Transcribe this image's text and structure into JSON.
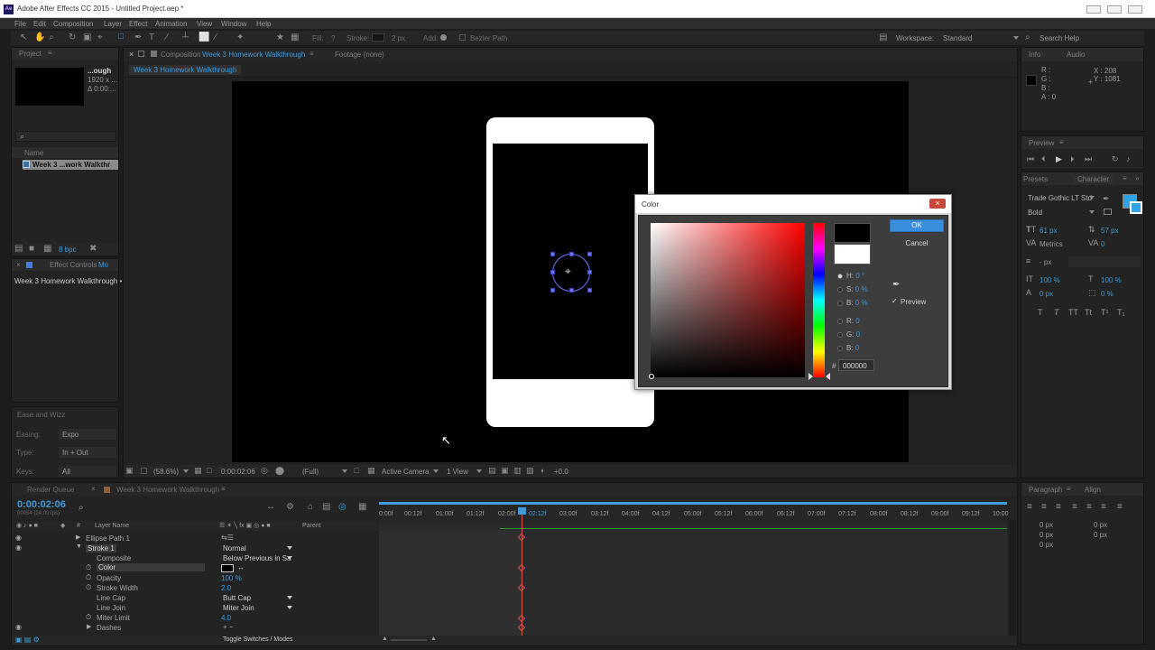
{
  "window": {
    "title": "Adobe After Effects CC 2015 - Untitled Project.aep *",
    "app_badge": "Ae"
  },
  "menu": [
    "File",
    "Edit",
    "Composition",
    "Layer",
    "Effect",
    "Animation",
    "View",
    "Window",
    "Help"
  ],
  "toolbar": {
    "fill_label": "Fill:",
    "fill_value": "?",
    "stroke_label": "Stroke:",
    "stroke_width": "2 px",
    "add_label": "Add:",
    "bezier_label": "Bezier Path",
    "workspace_label": "Workspace:",
    "workspace_value": "Standard",
    "search_placeholder": "Search Help"
  },
  "project": {
    "tab_label": "Project",
    "thumb_name": "...ough",
    "thumb_dims": "1920 x ...",
    "thumb_dur": "Δ 0:00:...",
    "search_icon": "search-icon",
    "col_name": "Name",
    "item_name": "Week 3 ...work Walkthr",
    "bpc": "8 bpc"
  },
  "effect_controls": {
    "tab_label": "Effect Controls",
    "tab_suffix": "Mo",
    "layer": "Week 3 Homework Walkthrough •"
  },
  "ease_panel": {
    "title": "Ease and Wizz",
    "easing_label": "Easing:",
    "easing_value": "Expo",
    "type_label": "Type:",
    "type_value": "In + Out",
    "keys_label": "Keys:",
    "keys_value": "All"
  },
  "comp_panel": {
    "close": "×",
    "tab_prefix": "Composition",
    "tab_name": "Week 3 Homework Walkthrough",
    "footage_tab": "Footage (none)",
    "breadcrumb": "Week 3 Homework Walkthrough",
    "zoom": "(58.6%)",
    "timecode": "0:00:02:06",
    "quality": "(Full)",
    "camera": "Active Camera",
    "views": "1 View",
    "exposure": "+0.0"
  },
  "info_panel": {
    "tab_info": "Info",
    "tab_audio": "Audio",
    "r": "R :",
    "g": "G :",
    "b": "B :",
    "a": "A : 0",
    "x": "X : 208",
    "y": "Y : 1081"
  },
  "preview_panel": {
    "tab": "Preview"
  },
  "character_panel": {
    "tab_presets": "Presets",
    "tab_character": "Character",
    "font": "Trade Gothic LT Std",
    "style": "Bold",
    "size": "61 px",
    "leading": "57 px",
    "kerning": "Metrics",
    "tracking": "0",
    "stroke_px": "- px",
    "vscale": "100 %",
    "hscale": "100 %",
    "baseline": "0 px",
    "tsume": "0 %"
  },
  "paragraph_panel": {
    "tab_paragraph": "Paragraph",
    "tab_align": "Align",
    "indent_left": "0 px",
    "indent_right": "0 px",
    "space_before": "0 px",
    "space_after": "0 px",
    "first_line": "0 px"
  },
  "timeline": {
    "tab_render_queue": "Render Queue",
    "tab_comp": "Week 3 Homework Walkthrough",
    "timecode": "0:00:02:06",
    "frame_info": "00054 (24.00 fps)",
    "col_layer_name": "Layer Name",
    "col_parent": "Parent",
    "ruler": [
      "0:00f",
      "00:12f",
      "01:00f",
      "01:12f",
      "02:00f",
      "02:12f",
      "03:00f",
      "03:12f",
      "04:00f",
      "04:12f",
      "05:00f",
      "05:12f",
      "06:00f",
      "06:12f",
      "07:00f",
      "07:12f",
      "08:00f",
      "08:12f",
      "09:00f",
      "09:12f",
      "10:00"
    ],
    "rows": [
      {
        "name": "Ellipse Path 1",
        "value": ""
      },
      {
        "name": "Stroke 1",
        "value": "Normal"
      },
      {
        "name": "Composite",
        "value": "Below Previous in Sa"
      },
      {
        "name": "Color",
        "value": ""
      },
      {
        "name": "Opacity",
        "value": "100 %"
      },
      {
        "name": "Stroke Width",
        "value": "2.0"
      },
      {
        "name": "Line Cap",
        "value": "Butt Cap"
      },
      {
        "name": "Line Join",
        "value": "Miter Join"
      },
      {
        "name": "Miter Limit",
        "value": "4.0"
      },
      {
        "name": "Dashes",
        "value": ""
      }
    ],
    "toggle_label": "Toggle Switches / Modes"
  },
  "color_dialog": {
    "title": "Color",
    "ok": "OK",
    "cancel": "Cancel",
    "h_label": "H:",
    "h_value": "0 °",
    "s_label": "S:",
    "s_value": "0 %",
    "b_label": "B:",
    "b_value": "0 %",
    "r_label": "R:",
    "r_value": "0",
    "g_label": "G:",
    "g_value": "0",
    "bb_label": "B:",
    "bb_value": "0",
    "hex_label": "#",
    "hex_value": "000000",
    "preview_label": "Preview",
    "new_color": "#000000",
    "old_color": "#ffffff"
  },
  "colors": {
    "accent": "#3e9ad8",
    "keyframe": "#d9534f",
    "work_area": "#2a9b2a",
    "selection": "#6f74ff"
  }
}
